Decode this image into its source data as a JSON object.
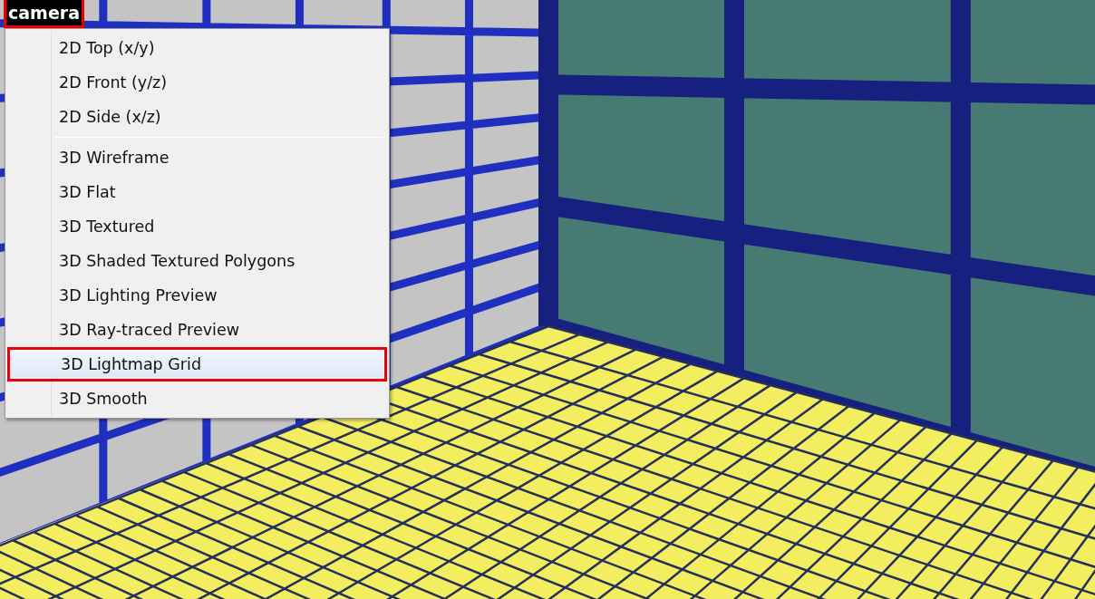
{
  "viewport": {
    "label": "camera"
  },
  "menu": {
    "groups": [
      [
        {
          "label": "2D Top (x/y)",
          "selected": false
        },
        {
          "label": "2D Front (y/z)",
          "selected": false
        },
        {
          "label": "2D Side (x/z)",
          "selected": false
        }
      ],
      [
        {
          "label": "3D Wireframe",
          "selected": false
        },
        {
          "label": "3D Flat",
          "selected": false
        },
        {
          "label": "3D Textured",
          "selected": false
        },
        {
          "label": "3D Shaded Textured Polygons",
          "selected": false
        },
        {
          "label": "3D Lighting Preview",
          "selected": false
        },
        {
          "label": "3D Ray-traced Preview",
          "selected": false
        },
        {
          "label": "3D Lightmap Grid",
          "selected": true
        },
        {
          "label": "3D Smooth",
          "selected": false
        }
      ]
    ]
  }
}
